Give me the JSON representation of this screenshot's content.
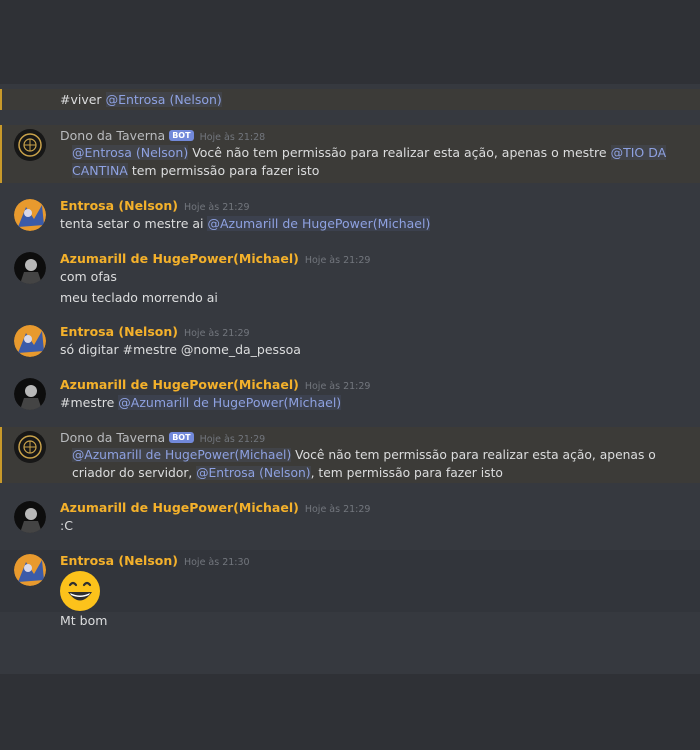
{
  "messages": {
    "m0": {
      "text": "#viver",
      "mention": "@Entrosa (Nelson)"
    },
    "m1": {
      "author": "Dono da Taverna",
      "badge": "BOT",
      "time": "Hoje às 21:28",
      "mention1": "@Entrosa (Nelson)",
      "text1": " Você não tem permissão para realizar esta ação, apenas o mestre ",
      "mention2": "@TIO DA CANTINA",
      "text2": " tem permissão para fazer isto"
    },
    "m2": {
      "author": "Entrosa (Nelson)",
      "time": "Hoje às 21:29",
      "text": "tenta setar o mestre ai ",
      "mention": "@Azumarill de HugePower(Michael)"
    },
    "m3": {
      "author": "Azumarill de HugePower(Michael)",
      "time": "Hoje às 21:29",
      "line1": "com ofas",
      "line2": "meu teclado morrendo ai"
    },
    "m4": {
      "author": "Entrosa (Nelson)",
      "time": "Hoje às 21:29",
      "text": "só digitar #mestre @nome_da_pessoa"
    },
    "m5": {
      "author": "Azumarill de HugePower(Michael)",
      "time": "Hoje às 21:29",
      "text": "#mestre ",
      "mention": "@Azumarill de HugePower(Michael)"
    },
    "m6": {
      "author": "Dono da Taverna",
      "badge": "BOT",
      "time": "Hoje às 21:29",
      "mention1": "@Azumarill de HugePower(Michael)",
      "text1": " Você não tem permissão para realizar esta ação, apenas o criador do servidor, ",
      "mention2": "@Entrosa (Nelson)",
      "text2": ", tem permissão para fazer isto"
    },
    "m7": {
      "author": "Azumarill de HugePower(Michael)",
      "time": "Hoje às 21:29",
      "text": ":C"
    },
    "m8": {
      "author": "Entrosa (Nelson)",
      "time": "Hoje às 21:30",
      "emoji": "grinning-face-emoji",
      "text": "Mt bom"
    }
  },
  "colors": {
    "username": "#f4b12b",
    "mention": "#8ea1e1",
    "highlight_bar": "#c99a2a",
    "bot_badge": "#7289da"
  }
}
